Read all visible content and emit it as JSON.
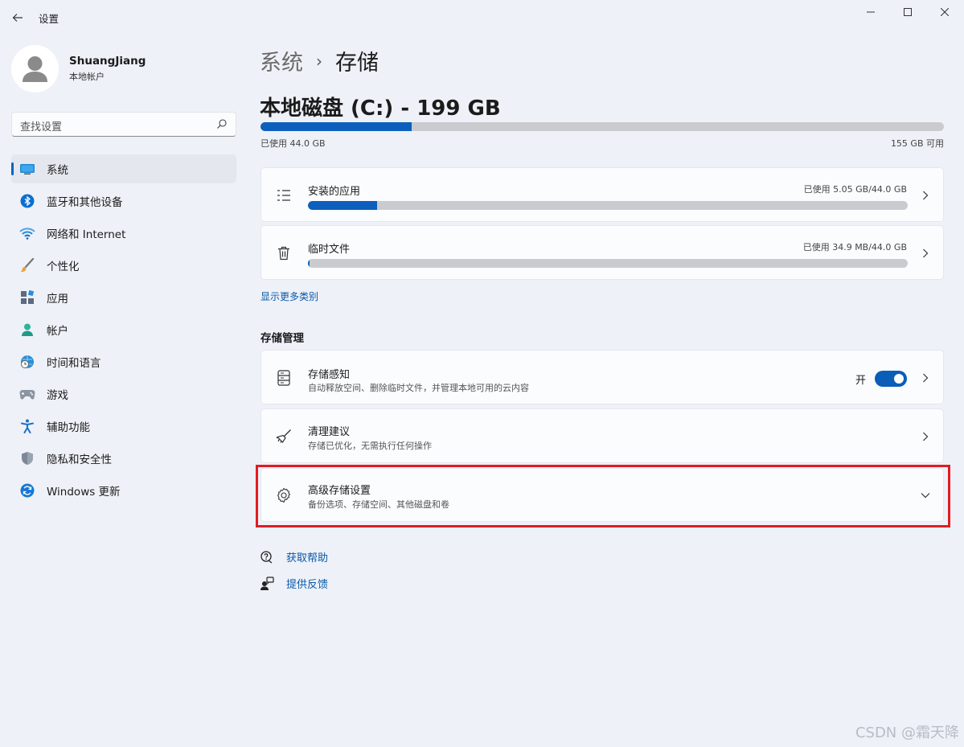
{
  "window": {
    "title": "设置",
    "back_icon": "arrow-left-icon",
    "controls": [
      "minimize-icon",
      "maximize-icon",
      "close-icon"
    ]
  },
  "profile": {
    "name": "ShuangJiang",
    "account_type": "本地帐户"
  },
  "search": {
    "placeholder": "查找设置"
  },
  "nav": {
    "items": [
      {
        "label": "系统",
        "icon": "system-display-icon",
        "active": true
      },
      {
        "label": "蓝牙和其他设备",
        "icon": "bluetooth-icon"
      },
      {
        "label": "网络和 Internet",
        "icon": "wifi-icon"
      },
      {
        "label": "个性化",
        "icon": "paintbrush-icon"
      },
      {
        "label": "应用",
        "icon": "apps-icon"
      },
      {
        "label": "帐户",
        "icon": "account-icon"
      },
      {
        "label": "时间和语言",
        "icon": "globe-clock-icon"
      },
      {
        "label": "游戏",
        "icon": "gamepad-icon"
      },
      {
        "label": "辅助功能",
        "icon": "accessibility-icon"
      },
      {
        "label": "隐私和安全性",
        "icon": "shield-icon"
      },
      {
        "label": "Windows 更新",
        "icon": "windows-update-icon"
      }
    ]
  },
  "breadcrumb": {
    "parent": "系统",
    "separator": "›",
    "current": "存储"
  },
  "drive": {
    "title": "本地磁盘 (C:) - 199 GB",
    "used_label": "已使用 44.0 GB",
    "free_label": "155 GB 可用",
    "used_fraction": 0.221
  },
  "categories": [
    {
      "title": "安装的应用",
      "usage": "已使用 5.05 GB/44.0 GB",
      "fraction": 0.115,
      "icon": "list-icon"
    },
    {
      "title": "临时文件",
      "usage": "已使用 34.9 MB/44.0 GB",
      "fraction": 0.001,
      "icon": "trash-icon"
    }
  ],
  "more_link": "显示更多类别",
  "management": {
    "section_title": "存储管理",
    "storage_sense": {
      "title": "存储感知",
      "subtitle": "自动释放空间、删除临时文件，并管理本地可用的云内容",
      "toggle_label": "开",
      "toggle_on": true
    },
    "cleanup": {
      "title": "清理建议",
      "subtitle": "存储已优化，无需执行任何操作"
    },
    "advanced": {
      "title": "高级存储设置",
      "subtitle": "备份选项、存储空间、其他磁盘和卷"
    }
  },
  "help": {
    "get_help": "获取帮助",
    "feedback": "提供反馈"
  },
  "watermark": "CSDN @霜天降",
  "colors": {
    "accent": "#0c5fbd",
    "highlight_border": "#e21c23",
    "link": "#0859a8"
  }
}
